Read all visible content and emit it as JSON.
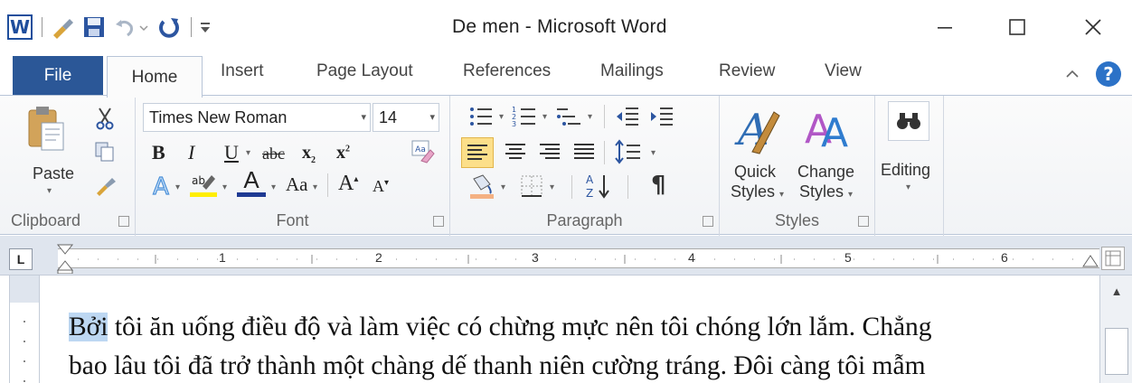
{
  "window": {
    "title": "De men  -  Microsoft Word",
    "app_icon_letter": "W"
  },
  "tabs": [
    "File",
    "Home",
    "Insert",
    "Page Layout",
    "References",
    "Mailings",
    "Review",
    "View"
  ],
  "ribbon": {
    "clipboard": {
      "paste_label": "Paste",
      "group_label": "Clipboard"
    },
    "font": {
      "font_name": "Times New Roman",
      "font_size": "14",
      "bold": "B",
      "italic": "I",
      "underline": "U",
      "strikethrough": "abc",
      "subscript": "x",
      "superscript": "x",
      "change_case": "Aa",
      "grow": "A",
      "shrink": "A",
      "font_color": "A",
      "group_label": "Font"
    },
    "paragraph": {
      "pilcrow": "¶",
      "group_label": "Paragraph"
    },
    "styles": {
      "quick_styles_1": "Quick",
      "quick_styles_2": "Styles",
      "change_styles_1": "Change",
      "change_styles_2": "Styles",
      "group_label": "Styles"
    },
    "editing": {
      "label": "Editing"
    }
  },
  "ruler": {
    "numbers": [
      "1",
      "2",
      "3",
      "4",
      "5",
      "6"
    ],
    "tab_selector": "L"
  },
  "document": {
    "selected_word": "Bởi",
    "line1_rest": " tôi ăn uống điều độ và làm việc có chừng mực nên tôi chóng lớn lắm. Chẳng",
    "line2": "bao lâu tôi đã trở thành một chàng dế thanh niên cường tráng. Đôi càng tôi mẫm"
  },
  "colors": {
    "file_tab": "#2b5797",
    "selection": "#bdd7f2",
    "ribbon_border": "#b8c5d8"
  }
}
